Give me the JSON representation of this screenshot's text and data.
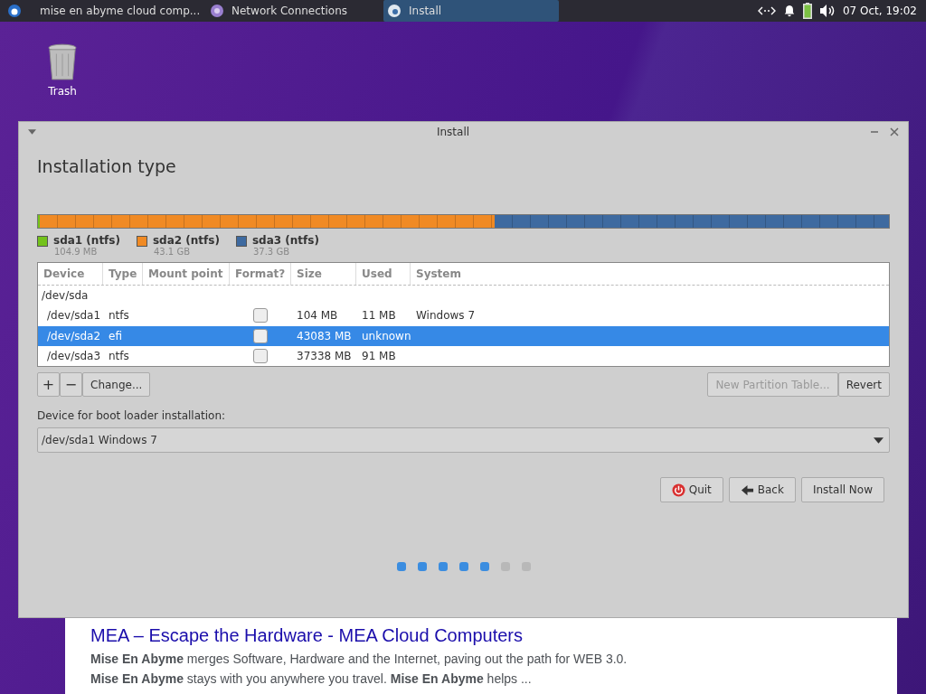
{
  "taskbar": {
    "tasks": [
      {
        "label": "mise en abyme cloud comp...",
        "kind": "browser",
        "selected": false
      },
      {
        "label": "Network Connections",
        "kind": "network",
        "selected": false
      },
      {
        "label": "Install",
        "kind": "installer",
        "selected": true
      }
    ],
    "clock": "07 Oct, 19:02"
  },
  "desktop": {
    "icons": [
      {
        "label": "Trash"
      }
    ]
  },
  "browser_result": {
    "title": "MEA – Escape the Hardware - MEA Cloud Computers",
    "lines": [
      "**Mise En Abyme** merges Software, Hardware and the Internet, paving out the path for WEB 3.0.",
      "**Mise En Abyme** stays with you anywhere you travel. **Mise En Abyme** helps ..."
    ]
  },
  "window": {
    "title": "Install",
    "heading": "Installation type",
    "partitions": [
      {
        "name": "sda1 (ntfs)",
        "size": "104.9 MB",
        "color": "#73c21b",
        "level": 0.002
      },
      {
        "name": "sda2 (ntfs)",
        "size": "43.1 GB",
        "color": "#f08a24",
        "level": 0.535
      },
      {
        "name": "sda3 (ntfs)",
        "size": "37.3 GB",
        "color": "#3e6aa0",
        "level": 0.463
      }
    ],
    "table": {
      "columns": [
        "Device",
        "Type",
        "Mount point",
        "Format?",
        "Size",
        "Used",
        "System"
      ],
      "disk": "/dev/sda",
      "rows": [
        {
          "device": "/dev/sda1",
          "type": "ntfs",
          "format": false,
          "size": "104 MB",
          "used": "11 MB",
          "system": "Windows 7",
          "selected": false
        },
        {
          "device": "/dev/sda2",
          "type": "efi",
          "format": false,
          "size": "43083 MB",
          "used": "unknown",
          "system": "",
          "selected": true
        },
        {
          "device": "/dev/sda3",
          "type": "ntfs",
          "format": false,
          "size": "37338 MB",
          "used": "91 MB",
          "system": "",
          "selected": false
        }
      ]
    },
    "tool_buttons": [
      "+",
      "−",
      "Change..."
    ],
    "new_table_button": {
      "label": "New Partition Table...",
      "disabled": true
    },
    "revert_button": "Revert",
    "bootloader_label": "Device for boot loader installation:",
    "bootloader_value": "/dev/sda1 Windows 7",
    "buttons": [
      {
        "label": "Quit",
        "kind": "quit"
      },
      {
        "label": "Back",
        "kind": "back"
      },
      {
        "label": "Install Now",
        "kind": "plain"
      }
    ],
    "steps": [
      {
        "done": true
      },
      {
        "done": true
      },
      {
        "done": true
      },
      {
        "done": true
      },
      {
        "done": true
      },
      {
        "done": false
      },
      {
        "done": false
      }
    ]
  }
}
